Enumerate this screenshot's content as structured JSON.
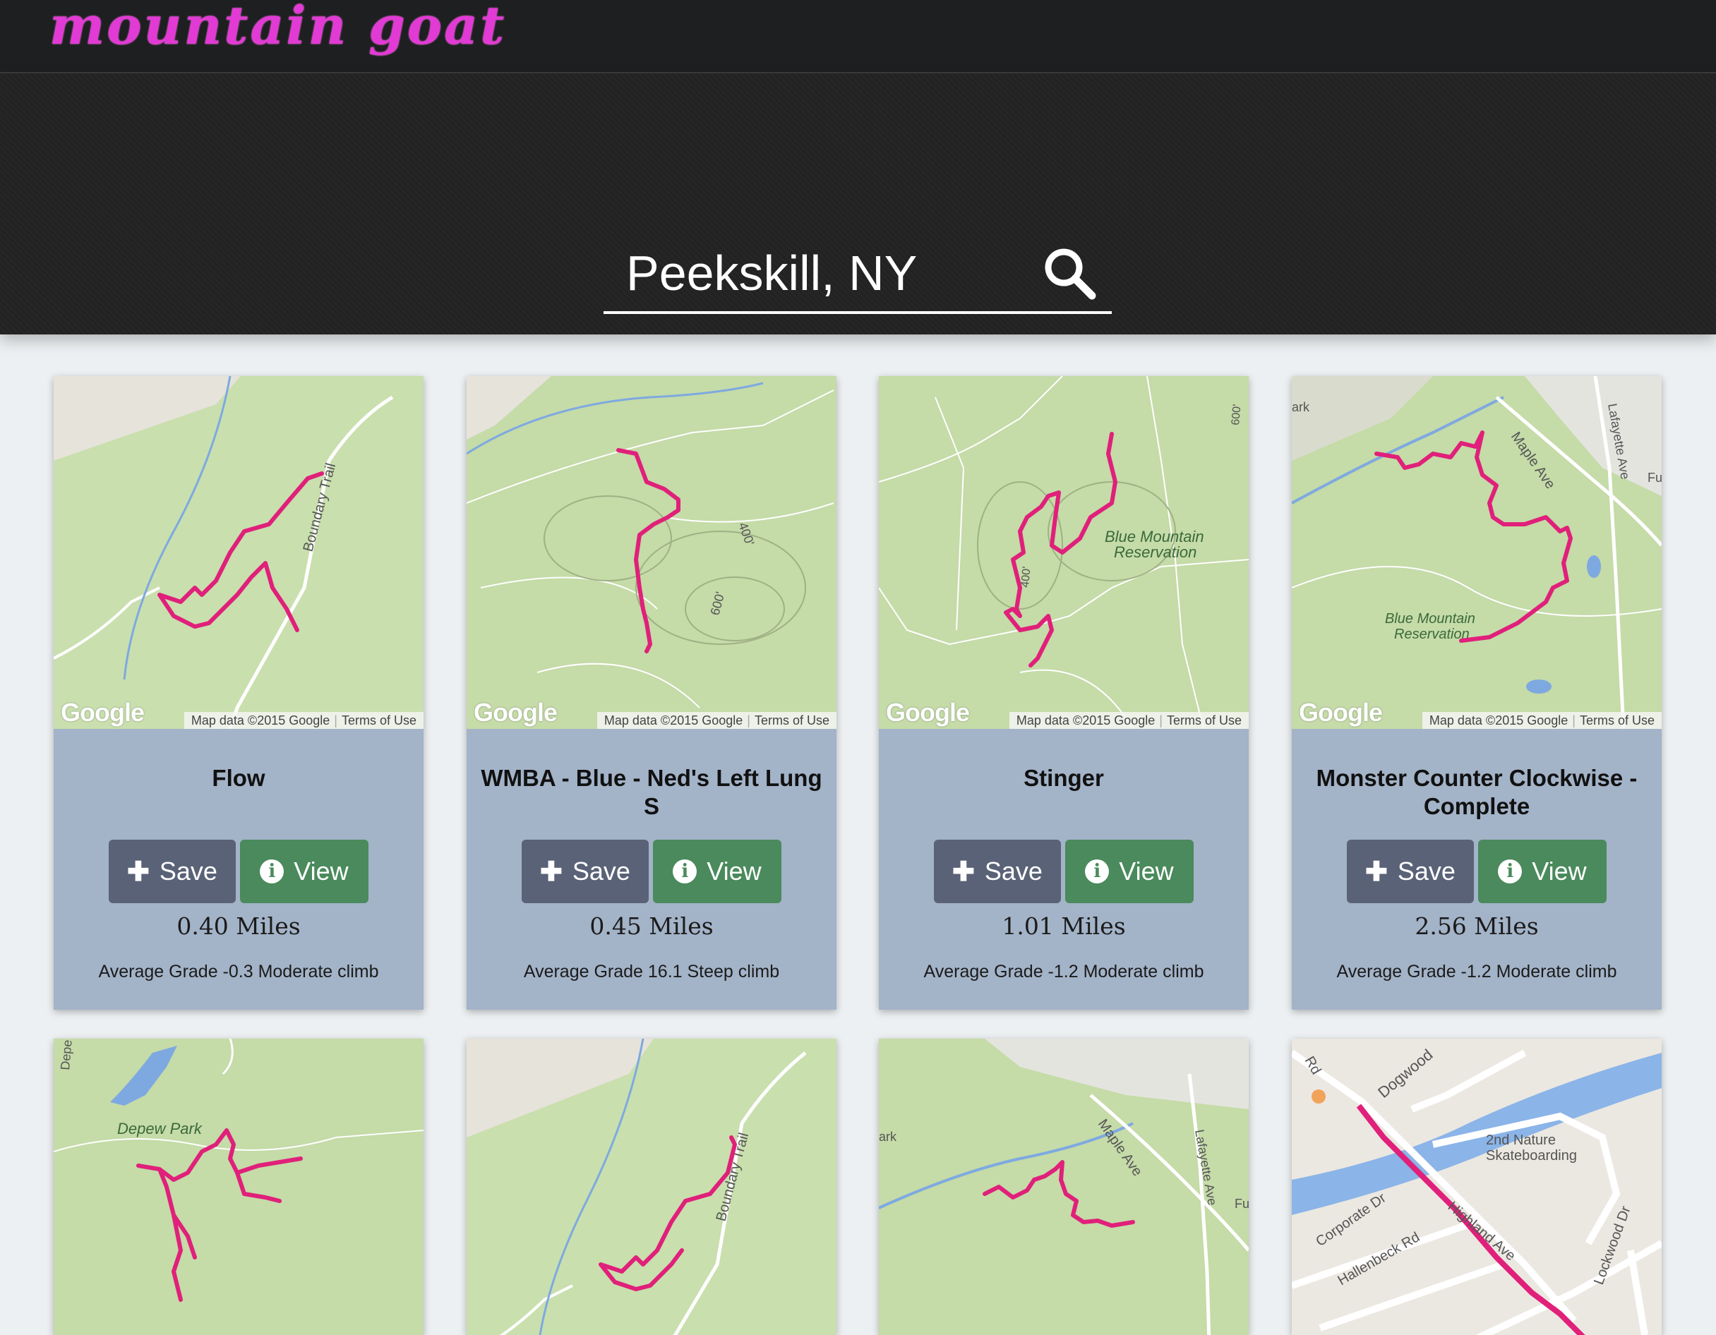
{
  "app": {
    "logo_text": "mountain goat"
  },
  "search": {
    "value": "Peekskill, NY"
  },
  "map_attribution": {
    "google": "Google",
    "map_data": "Map data ©2015 Google",
    "terms": "Terms of Use"
  },
  "colors": {
    "accent": "#e23ad4",
    "trail": "#e0207a",
    "save_button": "#5a6277",
    "view_button": "#4a8a5c",
    "card": "#a3b3c8"
  },
  "buttons": {
    "save_label": "Save",
    "view_label": "View"
  },
  "trails": [
    {
      "name": "Flow",
      "miles": "0.40 Miles",
      "grade": "Average Grade -0.3 Moderate climb",
      "map_labels": [
        "Boundary Trail"
      ]
    },
    {
      "name": "WMBA - Blue - Ned's Left Lung S",
      "miles": "0.45 Miles",
      "grade": "Average Grade 16.1 Steep climb",
      "map_labels": [
        "400'",
        "600'"
      ]
    },
    {
      "name": "Stinger",
      "miles": "1.01 Miles",
      "grade": "Average Grade -1.2 Moderate climb",
      "map_labels": [
        "Blue Mountain",
        "Reservation",
        "400'",
        "600'"
      ]
    },
    {
      "name": "Monster Counter Clockwise - Complete",
      "miles": "2.56 Miles",
      "grade": "Average Grade -1.2 Moderate climb",
      "map_labels": [
        "Maple Ave",
        "Lafayette Ave",
        "Blue Mountain",
        "Reservation",
        "ark",
        "Fu"
      ]
    }
  ],
  "row2_map_labels": {
    "card5": [
      "Depew Park",
      "Depe"
    ],
    "card6": [
      "Boundary Trail"
    ],
    "card7": [
      "Maple Ave",
      "Lafayette Ave",
      "ark",
      "Fu"
    ],
    "card8": [
      "Dogwood",
      "2nd Nature",
      "Skateboarding",
      "Corporate Dr",
      "Hallenbeck Rd",
      "Highland Ave",
      "Lockwood Dr",
      "Rd"
    ]
  }
}
